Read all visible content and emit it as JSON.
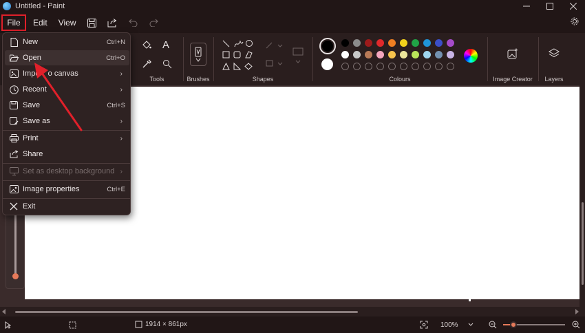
{
  "titlebar": {
    "title": "Untitled - Paint"
  },
  "menubar": {
    "file": "File",
    "edit": "Edit",
    "view": "View"
  },
  "ribbon": {
    "tools_label": "Tools",
    "brushes_label": "Brushes",
    "shapes_label": "Shapes",
    "colours_label": "Colours",
    "image_creator_label": "Image Creator",
    "layers_label": "Layers",
    "palette_row1": [
      "#000000",
      "#8c8c8c",
      "#9e1b1b",
      "#e0292b",
      "#f07f22",
      "#f2d11b",
      "#20a346",
      "#1f94d8",
      "#3b4fc8",
      "#a54bc9"
    ],
    "palette_row2": [
      "#ffffff",
      "#c8c8c8",
      "#b97a57",
      "#f4a6bd",
      "#f5c24c",
      "#ece59a",
      "#b8e45a",
      "#9fd5ee",
      "#7391b0",
      "#c8b5e6"
    ]
  },
  "file_menu": {
    "items": [
      {
        "label": "New",
        "shortcut": "Ctrl+N"
      },
      {
        "label": "Open",
        "shortcut": "Ctrl+O"
      },
      {
        "label": "Impo    o canvas"
      },
      {
        "label": "Recent"
      },
      {
        "label": "Save",
        "shortcut": "Ctrl+S"
      },
      {
        "label": "Save as"
      },
      {
        "label": "Print"
      },
      {
        "label": "Share"
      },
      {
        "label": "Set as desktop background"
      },
      {
        "label": "Image properties",
        "shortcut": "Ctrl+E"
      },
      {
        "label": "Exit"
      }
    ]
  },
  "statusbar": {
    "dimensions": "1914 × 861px",
    "zoom": "100%"
  }
}
